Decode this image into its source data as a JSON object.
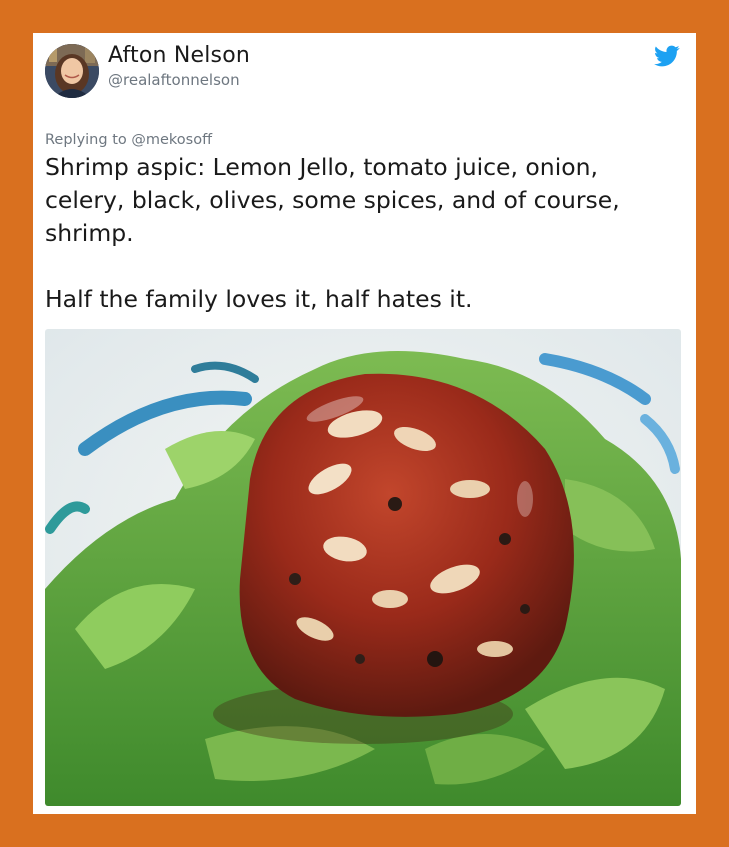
{
  "tweet": {
    "author_name": "Afton Nelson",
    "author_handle": "@realaftonnelson",
    "replying_prefix": "Replying to ",
    "replying_to": "@mekosoff",
    "text_line1": "Shrimp aspic: Lemon Jello, tomato juice, onion, celery, black, olives, some spices, and of course, shrimp.",
    "text_line2": "Half the family loves it, half hates it."
  },
  "icons": {
    "platform": "bird-icon"
  },
  "colors": {
    "frame": "#d9701f",
    "brand_blue": "#1da1f2"
  }
}
